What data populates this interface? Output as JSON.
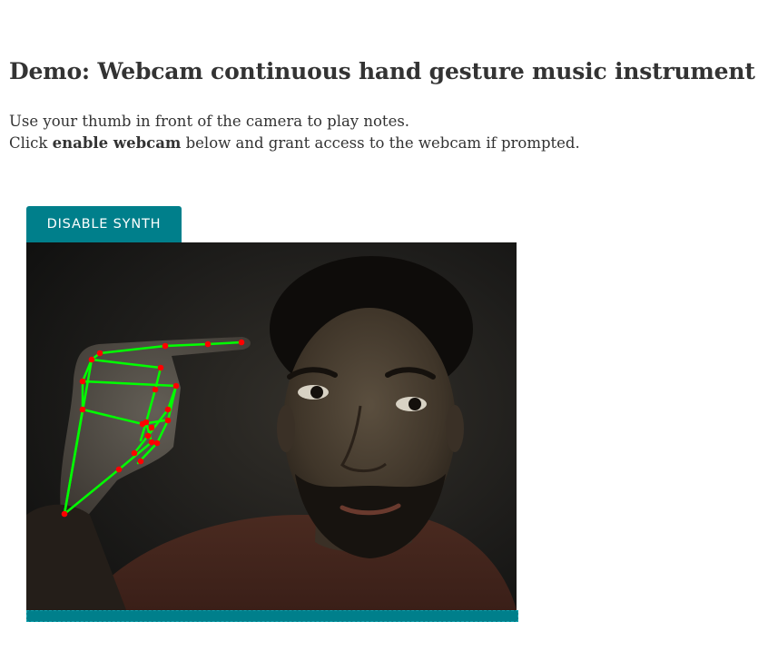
{
  "page": {
    "title": "Demo: Webcam continuous hand gesture music instrument",
    "intro_line1": "Use your thumb in front of the camera to play notes.",
    "intro_line2_prefix": "Click ",
    "intro_line2_bold": "enable webcam",
    "intro_line2_suffix": " below and grant access to the webcam if prompted."
  },
  "controls": {
    "synth_button_label": "DISABLE SYNTH"
  },
  "colors": {
    "accent": "#007f8b",
    "landmark_line": "#00ff00",
    "landmark_point": "#ff0000"
  }
}
